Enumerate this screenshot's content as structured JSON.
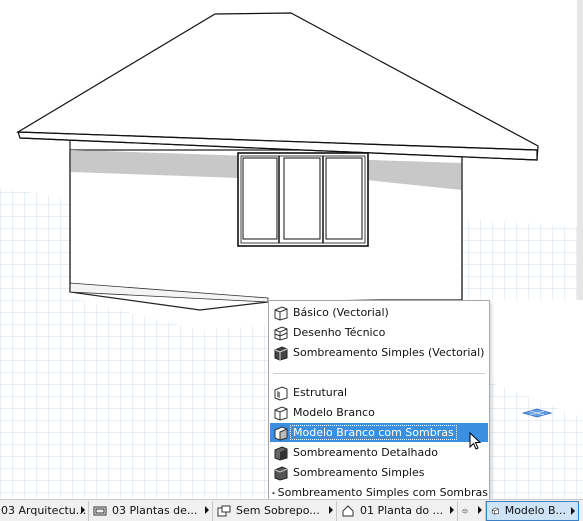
{
  "menu": {
    "items": [
      {
        "label": "Básico (Vectorial)",
        "icon": "basic-vector-icon",
        "selected": false
      },
      {
        "label": "Desenho Técnico",
        "icon": "technical-drawing-icon",
        "selected": false
      },
      {
        "label": "Sombreamento Simples (Vectorial)",
        "icon": "simple-shading-vector-icon",
        "selected": false
      },
      {
        "label": "Estrutural",
        "icon": "structural-icon",
        "selected": false
      },
      {
        "label": "Modelo Branco",
        "icon": "white-model-icon",
        "selected": false
      },
      {
        "label": "Modelo Branco com Sombras",
        "icon": "white-model-shadows-icon",
        "selected": true
      },
      {
        "label": "Sombreamento Detalhado",
        "icon": "detailed-shading-icon",
        "selected": false
      },
      {
        "label": "Sombreamento Simples",
        "icon": "simple-shading-icon",
        "selected": false
      },
      {
        "label": "Sombreamento Simples com Sombras",
        "icon": "simple-shading-shadows-icon",
        "selected": false
      }
    ]
  },
  "statusbar": {
    "items": [
      {
        "label": "03 Arquitectu...",
        "icon": "",
        "active": false
      },
      {
        "label": "03 Plantas de...",
        "icon": "rectangle-icon",
        "active": false
      },
      {
        "label": "Sem Sobrepo...",
        "icon": "layer-override-icon",
        "active": false
      },
      {
        "label": "01 Planta do ...",
        "icon": "house-icon",
        "active": false
      },
      {
        "label": "",
        "icon": "cube-icon",
        "active": false
      },
      {
        "label": "Modelo B...",
        "icon": "white-model-icon",
        "active": true
      }
    ]
  },
  "colors": {
    "selection": "#3b8fe0",
    "grid": "#b9cde6",
    "wall_shadow": "#c8c8c8"
  }
}
